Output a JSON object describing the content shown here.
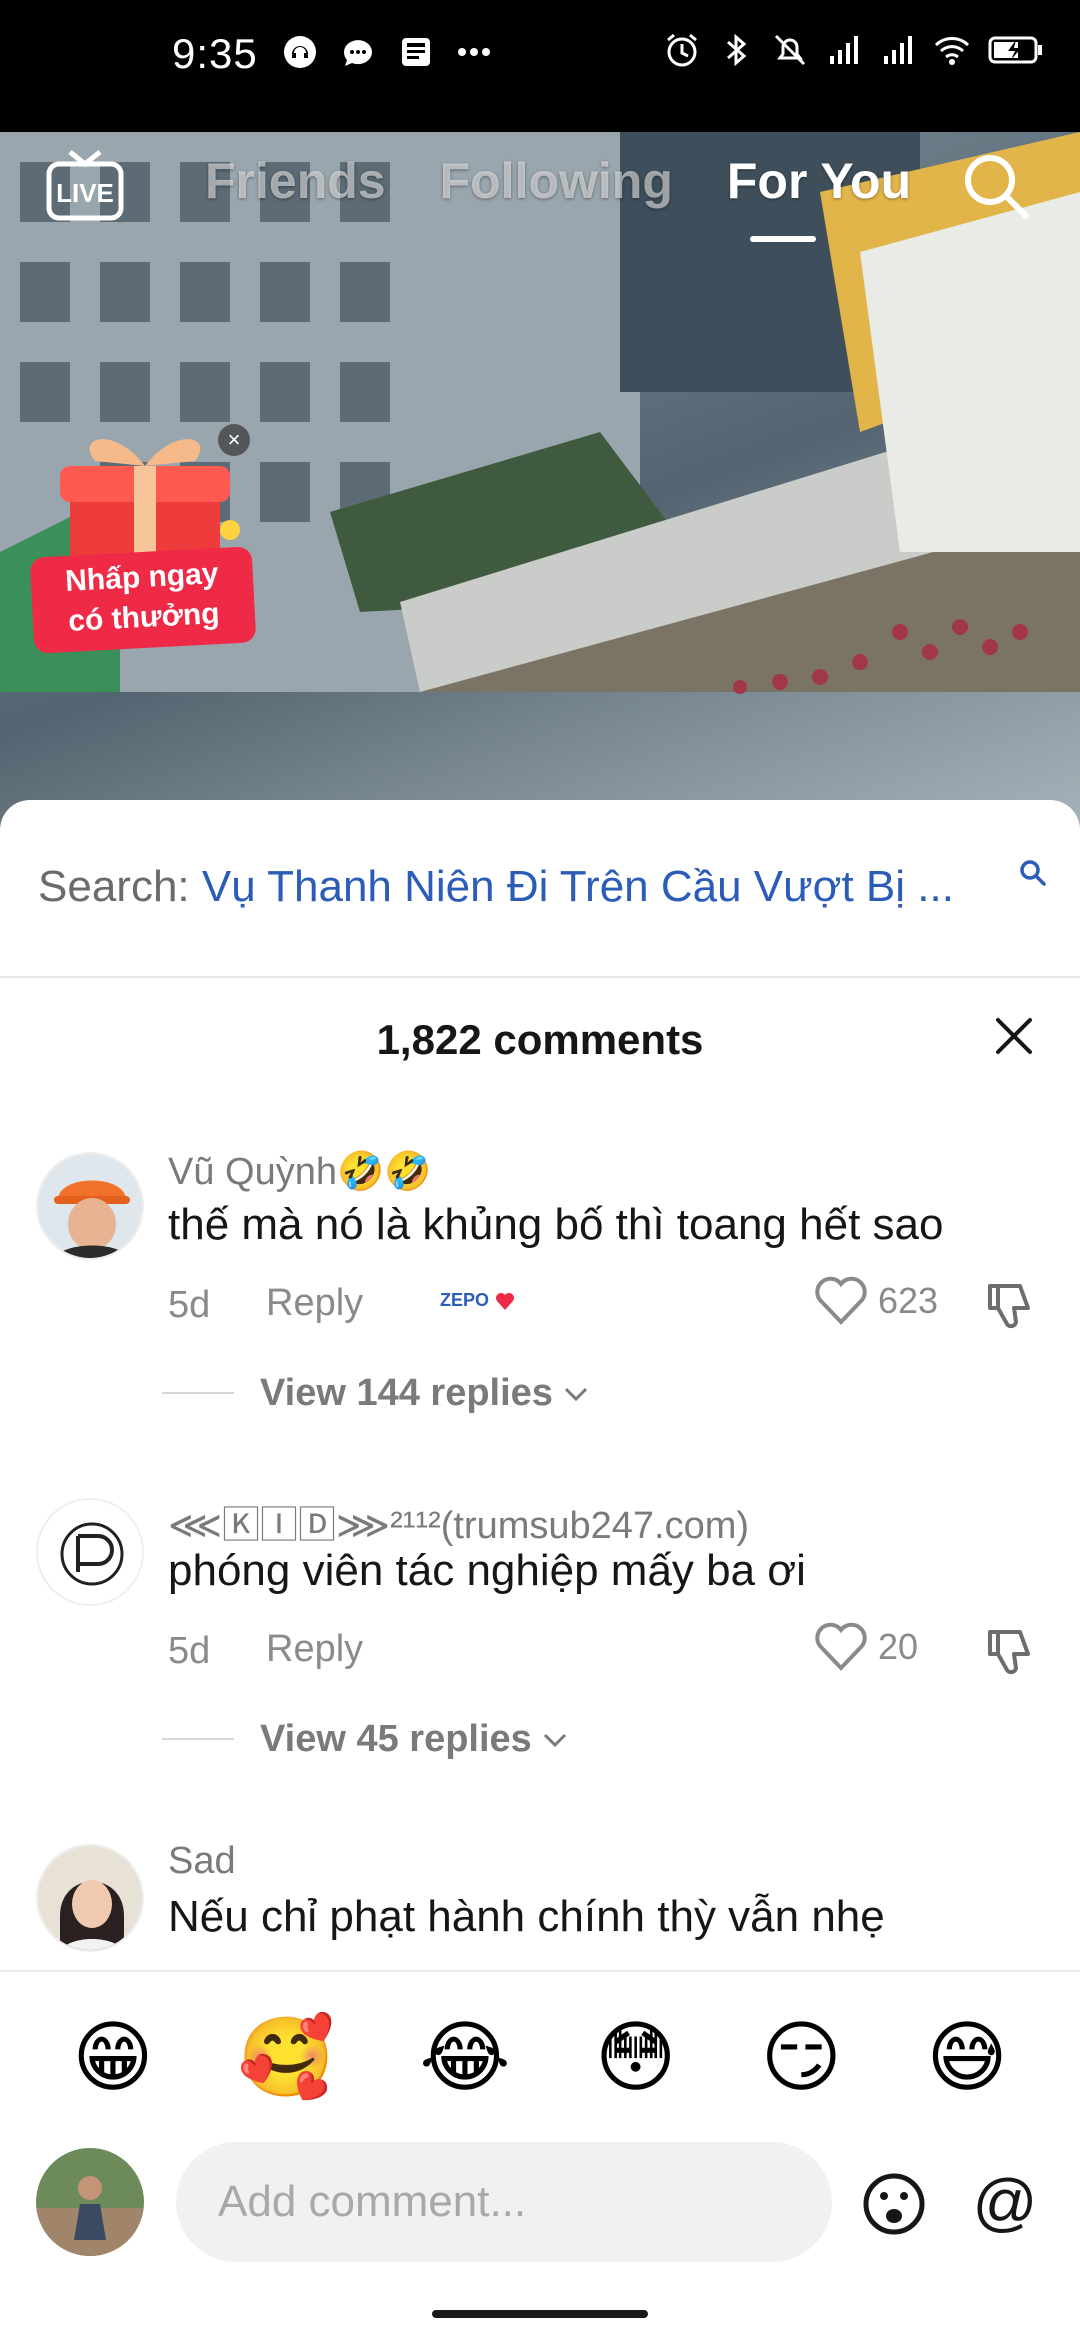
{
  "status_bar": {
    "time": "9:35",
    "icons": [
      "headset-icon",
      "chat-bubble-icon",
      "news-icon",
      "more-dots-icon",
      "alarm-icon",
      "bluetooth-icon",
      "bell-muted-icon",
      "signal-icon",
      "signal-icon",
      "wifi-icon",
      "battery-charging-icon"
    ]
  },
  "top_nav": {
    "live_label": "LIVE",
    "tabs": [
      {
        "label": "Friends",
        "active": false
      },
      {
        "label": "Following",
        "active": false
      },
      {
        "label": "For You",
        "active": true
      }
    ]
  },
  "promo": {
    "line1": "Nhấp ngay",
    "line2": "có thưởng",
    "close": "×"
  },
  "search_suggestion": {
    "prefix": "Search:",
    "term": "Vụ Thanh Niên Đi Trên Cầu Vượt Bị ..."
  },
  "comments_header": {
    "count_label": "1,822 comments"
  },
  "comments": [
    {
      "name": "Vũ Quỳnh🤣🤣",
      "text": "thế mà nó là khủng bố thì toang hết sao",
      "age": "5d",
      "reply_label": "Reply",
      "badge": "ZEPO",
      "likes": "623",
      "view_replies": "View 144 replies"
    },
    {
      "name": "⋘🄺🄸🄳⋙²¹¹²(trumsub247.com)",
      "text": "phóng viên tác nghiệp mấy ba ơi",
      "age": "5d",
      "reply_label": "Reply",
      "likes": "20",
      "view_replies": "View 45 replies"
    },
    {
      "name": "Sad",
      "text": "Nếu chỉ phạt hành chính thỳ vẫn nhẹ"
    }
  ],
  "emoji_bar": [
    "😁",
    "🥰",
    "😂",
    "😳",
    "😏",
    "😅"
  ],
  "composer": {
    "placeholder": "Add comment...",
    "at_symbol": "@"
  },
  "colors": {
    "accent_blue": "#2b5db8",
    "like_red": "#ef2a46",
    "text_primary": "#161616",
    "text_secondary": "#8a8a8a"
  }
}
